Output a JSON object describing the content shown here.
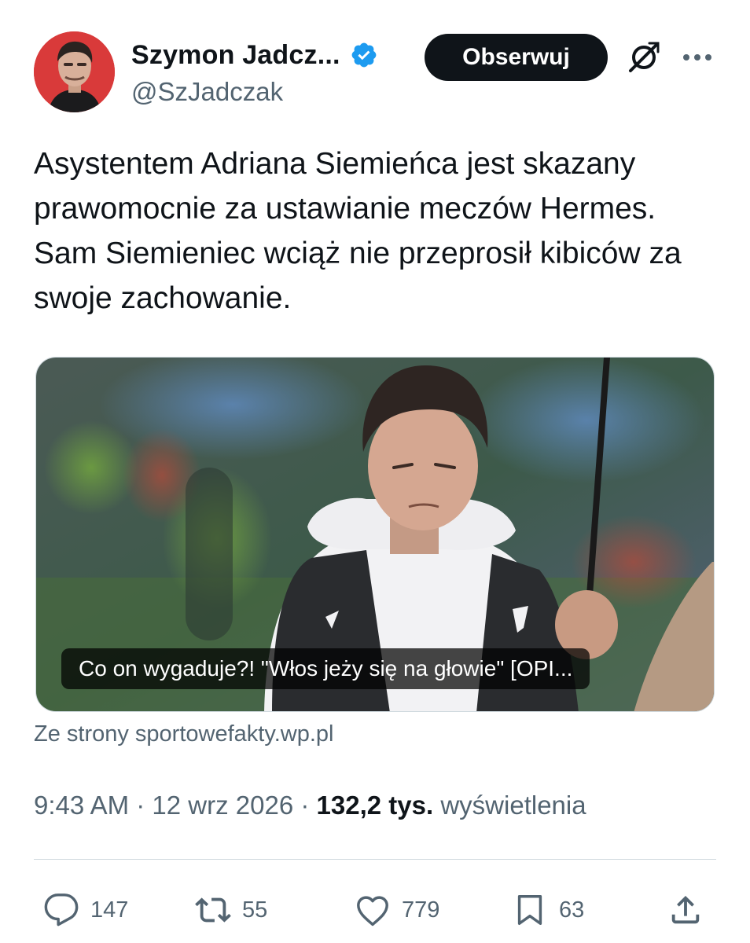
{
  "author": {
    "display_name": "Szymon Jadcz...",
    "handle": "@SzJadczak",
    "avatar_icon": "avatar",
    "verified_icon": "verified-badge-icon",
    "accent_color": "#1d9bf0"
  },
  "header": {
    "follow_label": "Obserwuj",
    "grok_icon": "grok-icon",
    "more_icon": "more-icon"
  },
  "tweet": {
    "text": "Asystentem Adriana Siemieńca jest skazany prawomocnie za ustawianie meczów Hermes. Sam Siemieniec wciąż nie przeprosił kibiców za swoje zachowanie."
  },
  "card": {
    "caption": "Co on wygaduje?! \"Włos jeży się na głowie\" [OPI...",
    "source": "Ze strony sportowefakty.wp.pl"
  },
  "meta": {
    "time": "9:43 AM",
    "date": "12 wrz 2026",
    "views_count": "132,2 tys.",
    "views_label": "wyświetlenia",
    "separator": "·"
  },
  "actions": {
    "replies": "147",
    "reposts": "55",
    "likes": "779",
    "bookmarks": "63"
  }
}
